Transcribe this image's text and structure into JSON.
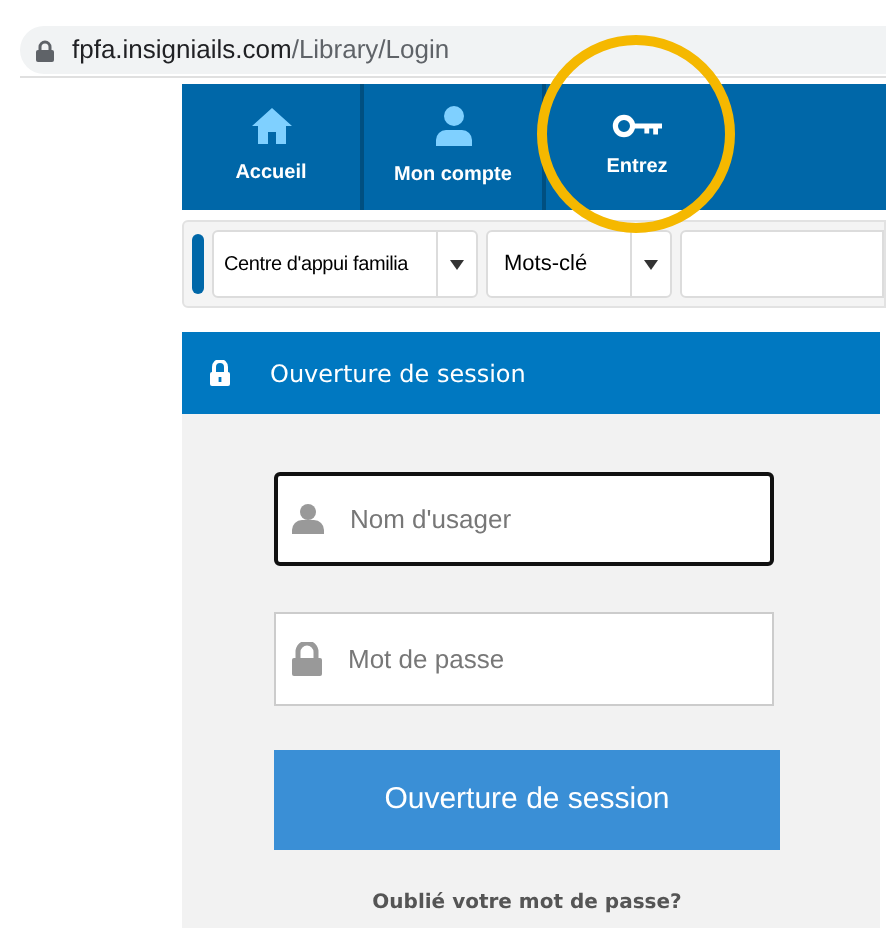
{
  "address_bar": {
    "domain": "fpfa.insigniails.com",
    "path": "/Library/Login"
  },
  "nav": [
    {
      "label": "Accueil",
      "kind": "home"
    },
    {
      "label": "Mon compte",
      "kind": "account"
    },
    {
      "label": "Entrez",
      "kind": "login",
      "highlighted": true
    }
  ],
  "search_bar": {
    "library_select": "Centre d'appui familia",
    "field_select": "Mots-clé"
  },
  "login_panel": {
    "title": "Ouverture de session",
    "fields": [
      {
        "placeholder": "Nom d'usager",
        "kind": "user",
        "focused": true
      },
      {
        "placeholder": "Mot de passe",
        "kind": "password",
        "focused": false
      }
    ],
    "submit": "Ouverture de session",
    "forgot_link": "Oublié votre mot de passe?"
  }
}
